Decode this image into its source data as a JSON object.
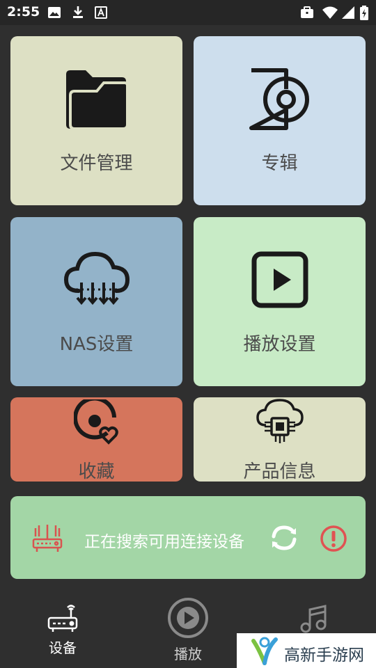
{
  "status_bar": {
    "time": "2:55",
    "left_icons": [
      "image-icon",
      "download-icon",
      "text-a-icon"
    ],
    "right_icons": [
      "briefcase-icon",
      "wifi-icon",
      "signal-icon",
      "battery-icon"
    ]
  },
  "tiles": [
    {
      "label": "文件管理",
      "icon": "folder-icon",
      "color": "#dde0c4"
    },
    {
      "label": "专辑",
      "icon": "album-disc-icon",
      "color": "#cddeed"
    },
    {
      "label": "NAS设置",
      "icon": "cloud-download-icon",
      "color": "#93b3c9"
    },
    {
      "label": "播放设置",
      "icon": "play-square-icon",
      "color": "#c8ebc6"
    },
    {
      "label": "收藏",
      "icon": "favorite-disc-icon",
      "color": "#d5755c"
    },
    {
      "label": "产品信息",
      "icon": "cloud-chip-icon",
      "color": "#dde0c4"
    }
  ],
  "banner": {
    "text": "正在搜索可用连接设备",
    "color": "#a3d6a6",
    "icons": [
      "router-icon",
      "refresh-icon",
      "alert-icon"
    ]
  },
  "bottom_nav": {
    "items": [
      {
        "label": "设备",
        "icon": "device-router-icon",
        "active": true
      },
      {
        "label": "播放",
        "icon": "play-circle-icon",
        "active": false
      },
      {
        "label": "",
        "icon": "music-note-icon",
        "active": false
      }
    ]
  },
  "watermark": {
    "text": "高新手游网"
  }
}
